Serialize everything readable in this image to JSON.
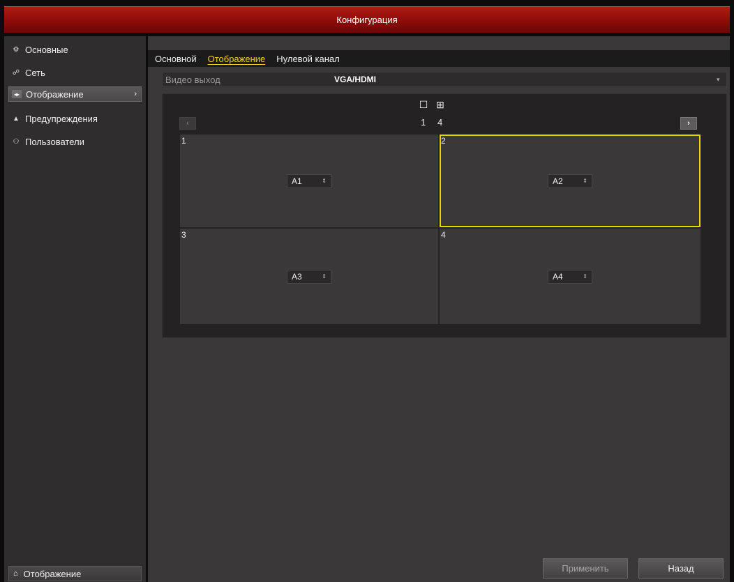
{
  "window": {
    "title": "Конфигурация"
  },
  "sidebar": {
    "items": [
      {
        "label": "Основные",
        "icon": "gear-icon"
      },
      {
        "label": "Сеть",
        "icon": "network-icon"
      },
      {
        "label": "Отображение",
        "icon": "display-icon",
        "active": true
      },
      {
        "label": "Предупреждения",
        "icon": "warning-icon"
      },
      {
        "label": "Пользователи",
        "icon": "users-icon"
      }
    ],
    "bottom_nav": {
      "label": "Отображение",
      "icon": "home-icon"
    }
  },
  "tabs": [
    {
      "label": "Основной"
    },
    {
      "label": "Отображение",
      "active": true
    },
    {
      "label": "Нулевой канал"
    }
  ],
  "video_output": {
    "label": "Видео выход",
    "value": "VGA/HDMI"
  },
  "preview": {
    "layouts": [
      {
        "icon": "single-view-icon",
        "label": "1"
      },
      {
        "icon": "quad-view-icon",
        "label": "4"
      }
    ],
    "cells": [
      {
        "number": "1",
        "camera": "A1"
      },
      {
        "number": "2",
        "camera": "A2",
        "selected": true
      },
      {
        "number": "3",
        "camera": "A3"
      },
      {
        "number": "4",
        "camera": "A4"
      }
    ]
  },
  "buttons": {
    "apply": "Применить",
    "back": "Назад"
  },
  "colors": {
    "titlebar": "#9a100c",
    "accent_yellow": "#f2d21e",
    "selection": "#e6d800"
  }
}
